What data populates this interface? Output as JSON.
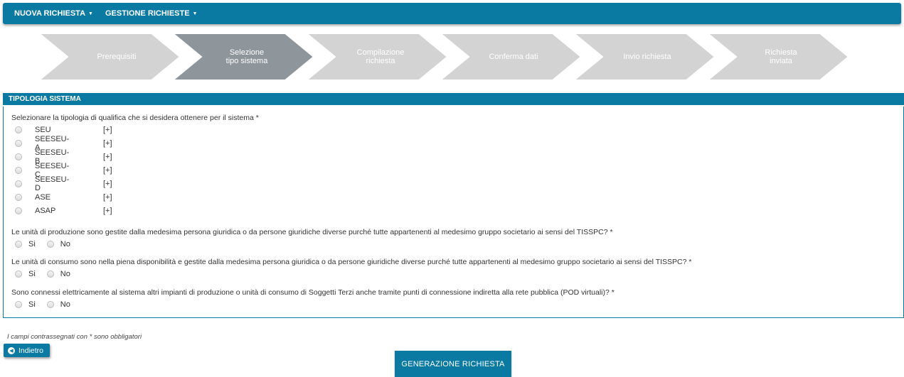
{
  "navbar": {
    "items": [
      {
        "label": "NUOVA RICHIESTA"
      },
      {
        "label": "GESTIONE RICHIESTE"
      }
    ]
  },
  "wizard": {
    "steps": [
      {
        "label": "Prerequisiti",
        "active": false
      },
      {
        "label": "Selezione\ntipo sistema",
        "active": true
      },
      {
        "label": "Compilazione\nrichiesta",
        "active": false
      },
      {
        "label": "Conferma dati",
        "active": false
      },
      {
        "label": "Invio richiesta",
        "active": false
      },
      {
        "label": "Richiesta\ninviata",
        "active": false
      }
    ],
    "active_color": "#8e959b",
    "inactive_color": "#d3d3d3"
  },
  "section": {
    "title": "TIPOLOGIA SISTEMA",
    "q1": "Selezionare la tipologia di qualifica che si desidera ottenere per il sistema *",
    "system_types": [
      {
        "label": "SEU",
        "more": "[+]"
      },
      {
        "label": "SEESEU-A",
        "more": "[+]"
      },
      {
        "label": "SEESEU-B",
        "more": "[+]"
      },
      {
        "label": "SEESEU-C",
        "more": "[+]"
      },
      {
        "label": "SEESEU-D",
        "more": "[+]"
      },
      {
        "label": "ASE",
        "more": "[+]"
      },
      {
        "label": "ASAP",
        "more": "[+]"
      }
    ],
    "q2": "Le unità di produzione sono gestite dalla medesima persona giuridica o da persone giuridiche diverse purché tutte appartenenti al medesimo gruppo societario ai sensi del TISSPC? *",
    "q3": "Le unità di consumo sono nella piena disponibilità e gestite dalla medesima persona giuridica o da persone giuridiche diverse purché tutte appartenenti al medesimo gruppo societario ai sensi del TISSPC? *",
    "q4": "Sono connessi elettricamente al sistema altri impianti di produzione o unità di consumo di Soggetti Terzi anche tramite punti di connessione indiretta alla rete pubblica (POD virtuali)? *",
    "yes_label": "Si",
    "no_label": "No"
  },
  "footer": {
    "required_note": "I campi contrassegnati con * sono obbligatori",
    "back_label": "Indietro",
    "generate_label": "GENERAZIONE RICHIESTA"
  },
  "colors": {
    "primary": "#0b7aa3"
  }
}
